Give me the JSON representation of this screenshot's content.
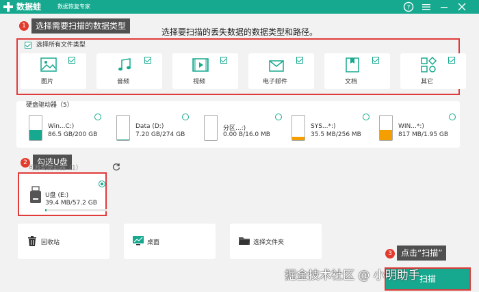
{
  "titlebar": {
    "app_name": "数据蛙",
    "subtitle": "数据恢复专家",
    "controls": [
      "help-icon",
      "menu-icon",
      "minimize-icon",
      "close-icon"
    ]
  },
  "annotations": {
    "step1": {
      "number": "1",
      "text": "选择需要扫描的数据类型"
    },
    "step2": {
      "number": "2",
      "text": "勾选U盘"
    },
    "step3": {
      "number": "3",
      "text": "点击“扫描”"
    }
  },
  "instruction": "选择要扫描的丢失数据的数据类型和路径。",
  "select_all": {
    "label": "选择所有文件类型",
    "checked": true
  },
  "file_types": [
    {
      "label": "图片",
      "icon": "image-icon",
      "checked": true
    },
    {
      "label": "音频",
      "icon": "music-icon",
      "checked": true
    },
    {
      "label": "视频",
      "icon": "video-icon",
      "checked": true
    },
    {
      "label": "电子邮件",
      "icon": "email-icon",
      "checked": true
    },
    {
      "label": "文档",
      "icon": "document-icon",
      "checked": true
    },
    {
      "label": "其它",
      "icon": "other-icon",
      "checked": true
    }
  ],
  "hard_drives": {
    "title": "硬盘驱动器（5）",
    "items": [
      {
        "name": "Win...C:)",
        "size": "86.5 GB/200 GB",
        "fill": 0.43,
        "color": "#16a98f"
      },
      {
        "name": "Data (D:)",
        "size": "7.20 GB/274 GB",
        "fill": 0.03,
        "color": "#16a98f"
      },
      {
        "name": "分区...:)",
        "size": "0.00  B/16.0 MB",
        "fill": 0.0,
        "color": "#16a98f"
      },
      {
        "name": "SYS...*:)",
        "size": "35.5 MB/256 MB",
        "fill": 0.14,
        "color": "#f59e00"
      },
      {
        "name": "WIN...*:)",
        "size": "817 MB/1.95 GB",
        "fill": 0.42,
        "color": "#f59e00"
      }
    ]
  },
  "removable": {
    "title": "可移动驱动器（1）",
    "items": [
      {
        "name": "U盘 (E:)",
        "size": "39.4 MB/57.2 GB",
        "fill": 0.01,
        "selected": true
      }
    ]
  },
  "locations": [
    {
      "label": "回收站",
      "icon": "recycle-bin-icon"
    },
    {
      "label": "桌面",
      "icon": "desktop-icon"
    },
    {
      "label": "选择文件夹",
      "icon": "folder-icon"
    }
  ],
  "scan_button": "扫描",
  "watermark": "掘金技术社区 @ 小明助手",
  "colors": {
    "accent": "#16a98f",
    "annotation_red": "#e13a3a",
    "warning": "#f59e00"
  }
}
